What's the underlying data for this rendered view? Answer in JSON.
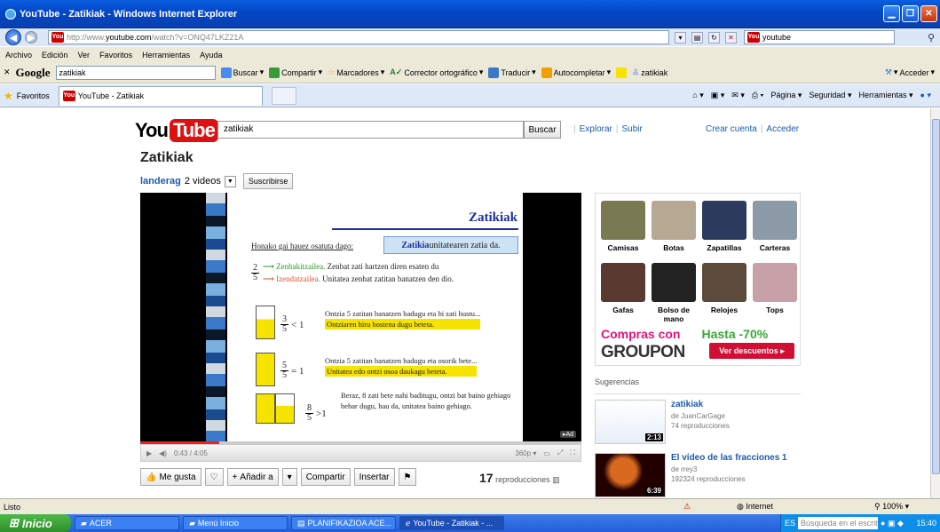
{
  "window": {
    "title": "YouTube - Zatikiak - Windows Internet Explorer"
  },
  "addressbar": {
    "url_prefix": "http://www.",
    "url_domain": "youtube.com",
    "url_rest": "/watch?v=ONQ47LKZ21A",
    "search_value": "youtube"
  },
  "menu": [
    "Archivo",
    "Edición",
    "Ver",
    "Favoritos",
    "Herramientas",
    "Ayuda"
  ],
  "googlebar": {
    "logo": "Google",
    "query": "zatikiak",
    "items": [
      "Buscar",
      "Compartir",
      "Marcadores",
      "Corrector ortográfico",
      "Traducir",
      "Autocompletar",
      "zatikiak",
      "Acceder"
    ]
  },
  "tabbar": {
    "favorites": "Favoritos",
    "tab": "YouTube - Zatikiak",
    "tools": [
      "Página",
      "Seguridad",
      "Herramientas"
    ]
  },
  "youtube": {
    "logo_you": "You",
    "logo_tube": "Tube",
    "search_value": "zatikiak",
    "search_button": "Buscar",
    "links": [
      "Explorar",
      "Subir"
    ],
    "account_links": [
      "Crear cuenta",
      "Acceder"
    ]
  },
  "video": {
    "title": "Zatikiak",
    "channel": "landerag",
    "video_count": "2 videos",
    "subscribe": "Suscribirse",
    "time": "0:43 / 4:05",
    "quality": "360p",
    "ad_badge": "Ad",
    "progress": 0.18
  },
  "slide": {
    "title": "Zatikiak",
    "intro": "Honako gai hauez osatuta dago:",
    "box_bold": "Zatikia",
    "box_rest": " unitatearen zatia da.",
    "num": "2",
    "den": "5",
    "zenb": "Zenbakitzailea.",
    "zenb_text": " Zenbat zati hartzen diren esaten du",
    "izen": "Izendatzailea.",
    "izen_text": " Unitatea zenbat zatitan banatzen den dio.",
    "r1_num": "3",
    "r1_den": "5",
    "r1_rel": "< 1",
    "r1_t1": "Ontzia 5 zatitan banatzen badugu eta bi zati hustu...",
    "r1_t2": "Ontziaren hiru bostena dugu beteta.",
    "r2_num": "5",
    "r2_den": "5",
    "r2_rel": "= 1",
    "r2_t1": "Ontzia 5 zatitan banatzen badugu eta osorik bete...",
    "r2_t2": "Unitatea edo ontzi osoa daukagu beteta.",
    "r3_num": "8",
    "r3_den": "5",
    "r3_rel": ">1",
    "r3_t": "Beraz, 8 zati bete nahi baditugu, ontzi bat baino gehiago behar dugu, hau da, unitatea baino gehiago."
  },
  "actions": {
    "like": "Me gusta",
    "add": "Añadir a",
    "share": "Compartir",
    "embed": "Insertar",
    "views_count": "17",
    "views_label": "reproducciones"
  },
  "ad": {
    "products": [
      "Camisas",
      "Botas",
      "Zapatillas",
      "Carteras",
      "Gafas",
      "Bolso de mano",
      "Relojes",
      "Tops"
    ],
    "promo_left": "Compras con",
    "promo_right": "Hasta -70%",
    "brand": "GROUPON",
    "cta": "Ver descuentos ▸"
  },
  "suggestions": {
    "header": "Sugerencias",
    "items": [
      {
        "title": "zatikiak",
        "author": "de JuanCarGage",
        "views": "74 reproducciones",
        "duration": "2:13"
      },
      {
        "title": "El vídeo de las fracciones 1",
        "author": "de rrey3",
        "views": "192324 reproducciones",
        "duration": "6:39"
      }
    ]
  },
  "status": {
    "text": "Listo",
    "zone": "Internet",
    "zoom": "100%"
  },
  "taskbar": {
    "start": "Inicio",
    "tasks": [
      "ACER",
      "Menú Inicio",
      "PLANIFIKAZIOA ACE...",
      "YouTube - Zatikiak - ..."
    ],
    "lang": "ES",
    "search_placeholder": "Búsqueda en el escrit...",
    "clock": "15:40"
  }
}
